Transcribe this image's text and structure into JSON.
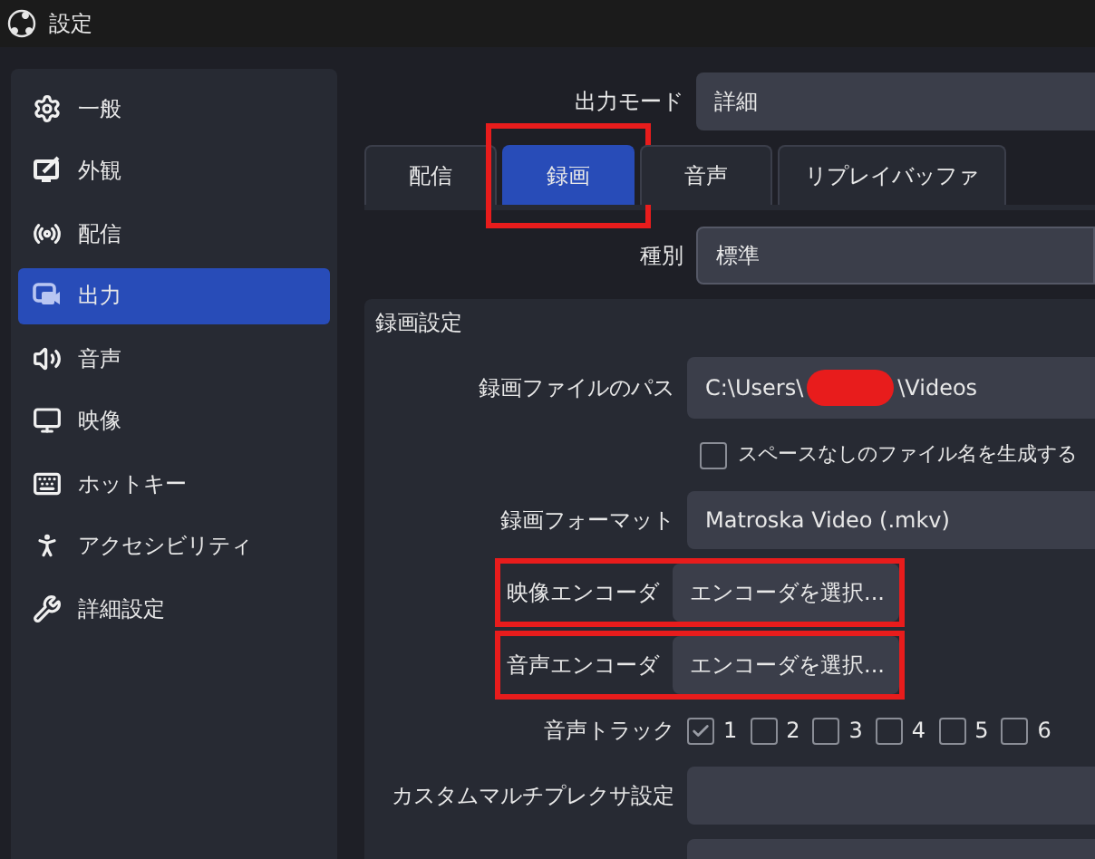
{
  "window": {
    "title": "設定"
  },
  "sidebar": {
    "items": [
      {
        "label": "一般",
        "selected": false
      },
      {
        "label": "外観",
        "selected": false
      },
      {
        "label": "配信",
        "selected": false
      },
      {
        "label": "出力",
        "selected": true
      },
      {
        "label": "音声",
        "selected": false
      },
      {
        "label": "映像",
        "selected": false
      },
      {
        "label": "ホットキー",
        "selected": false
      },
      {
        "label": "アクセシビリティ",
        "selected": false
      },
      {
        "label": "詳細設定",
        "selected": false
      }
    ]
  },
  "output_mode": {
    "label": "出力モード",
    "value": "詳細"
  },
  "tabs": [
    {
      "label": "配信",
      "selected": false,
      "highlighted": false
    },
    {
      "label": "録画",
      "selected": true,
      "highlighted": true
    },
    {
      "label": "音声",
      "selected": false,
      "highlighted": false
    },
    {
      "label": "リプレイバッファ",
      "selected": false,
      "highlighted": false
    }
  ],
  "type": {
    "label": "種別",
    "value": "標準"
  },
  "group": {
    "title": "録画設定",
    "rows": [
      {
        "kind": "path",
        "label": "録画ファイルのパス",
        "path_start": "C:\\Users\\",
        "path_end": "\\Videos",
        "redacted": true
      },
      {
        "kind": "checkbox",
        "label": "スペースなしのファイル名を生成する",
        "checked": false
      },
      {
        "kind": "select",
        "label": "録画フォーマット",
        "value": "Matroska Video (.mkv)",
        "short": false,
        "highlighted": false
      },
      {
        "kind": "select",
        "label": "映像エンコーダ",
        "value": "エンコーダを選択...",
        "short": true,
        "highlighted": true
      },
      {
        "kind": "select",
        "label": "音声エンコーダ",
        "value": "エンコーダを選択...",
        "short": true,
        "highlighted": true
      },
      {
        "kind": "tracks",
        "label": "音声トラック",
        "tracks": [
          {
            "label": "1",
            "checked": true
          },
          {
            "label": "2",
            "checked": false
          },
          {
            "label": "3",
            "checked": false
          },
          {
            "label": "4",
            "checked": false
          },
          {
            "label": "5",
            "checked": false
          },
          {
            "label": "6",
            "checked": false
          }
        ]
      },
      {
        "kind": "select",
        "label": "カスタムマルチプレクサ設定",
        "value": "",
        "short": false,
        "highlighted": false
      },
      {
        "kind": "blank"
      }
    ]
  }
}
